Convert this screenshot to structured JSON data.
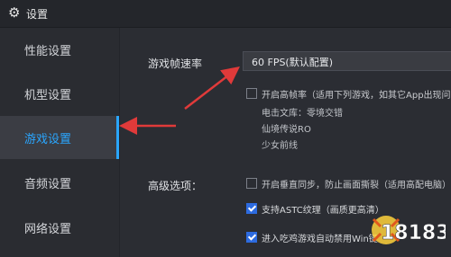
{
  "window": {
    "title": "设置"
  },
  "sidebar": {
    "items": [
      {
        "label": "性能设置"
      },
      {
        "label": "机型设置"
      },
      {
        "label": "游戏设置"
      },
      {
        "label": "音频设置"
      },
      {
        "label": "网络设置"
      }
    ]
  },
  "game_settings": {
    "fps_label": "游戏帧速率",
    "fps_value": "60 FPS(默认配置)",
    "high_fps_option": "开启高帧率（适用下列游戏，如其它App出现问",
    "high_fps_games": [
      "电击文库：零境交错",
      "仙境传说RO",
      "少女前线"
    ],
    "advanced_label": "高级选项：",
    "advanced_options": [
      {
        "label": "开启垂直同步，防止画面撕裂（适用高配电脑）",
        "checked": false
      },
      {
        "label": "支持ASTC纹理（画质更高清）",
        "checked": true
      },
      {
        "label": "进入吃鸡游戏自动禁用Win键",
        "checked": true
      }
    ]
  },
  "annotation_color": "#e03a3a",
  "accent_color": "#2aa6ff",
  "watermark": {
    "text": "18183"
  }
}
